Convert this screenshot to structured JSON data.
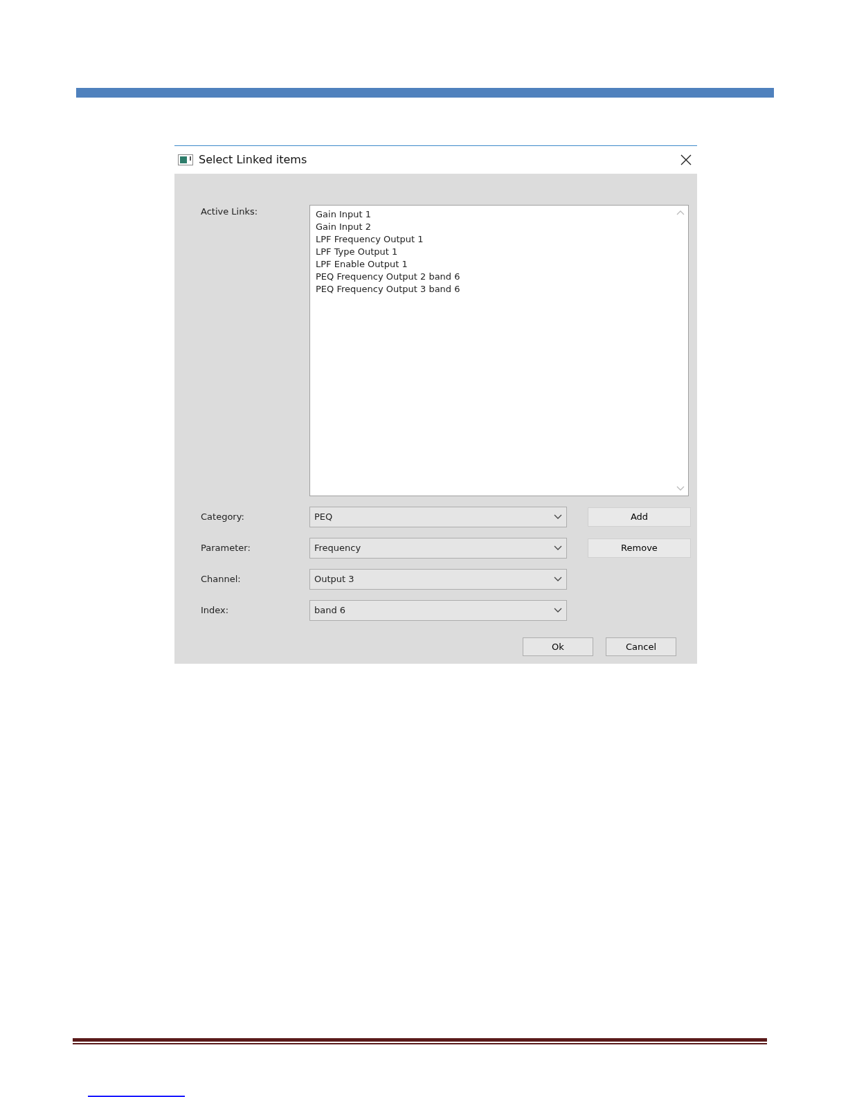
{
  "window": {
    "title": "Select Linked items"
  },
  "active_links": {
    "label": "Active Links:",
    "items": [
      "Gain Input 1",
      "Gain Input 2",
      "LPF Frequency Output 1",
      "LPF Type Output 1",
      "LPF Enable Output 1",
      "PEQ Frequency Output 2 band 6",
      "PEQ Frequency Output 3 band 6"
    ]
  },
  "fields": [
    {
      "label": "Category:",
      "value": "PEQ",
      "button": "Add"
    },
    {
      "label": "Parameter:",
      "value": "Frequency",
      "button": "Remove"
    },
    {
      "label": "Channel:",
      "value": "Output 3"
    },
    {
      "label": "Index:",
      "value": "band 6"
    }
  ],
  "buttons": [
    "Ok",
    "Cancel"
  ]
}
